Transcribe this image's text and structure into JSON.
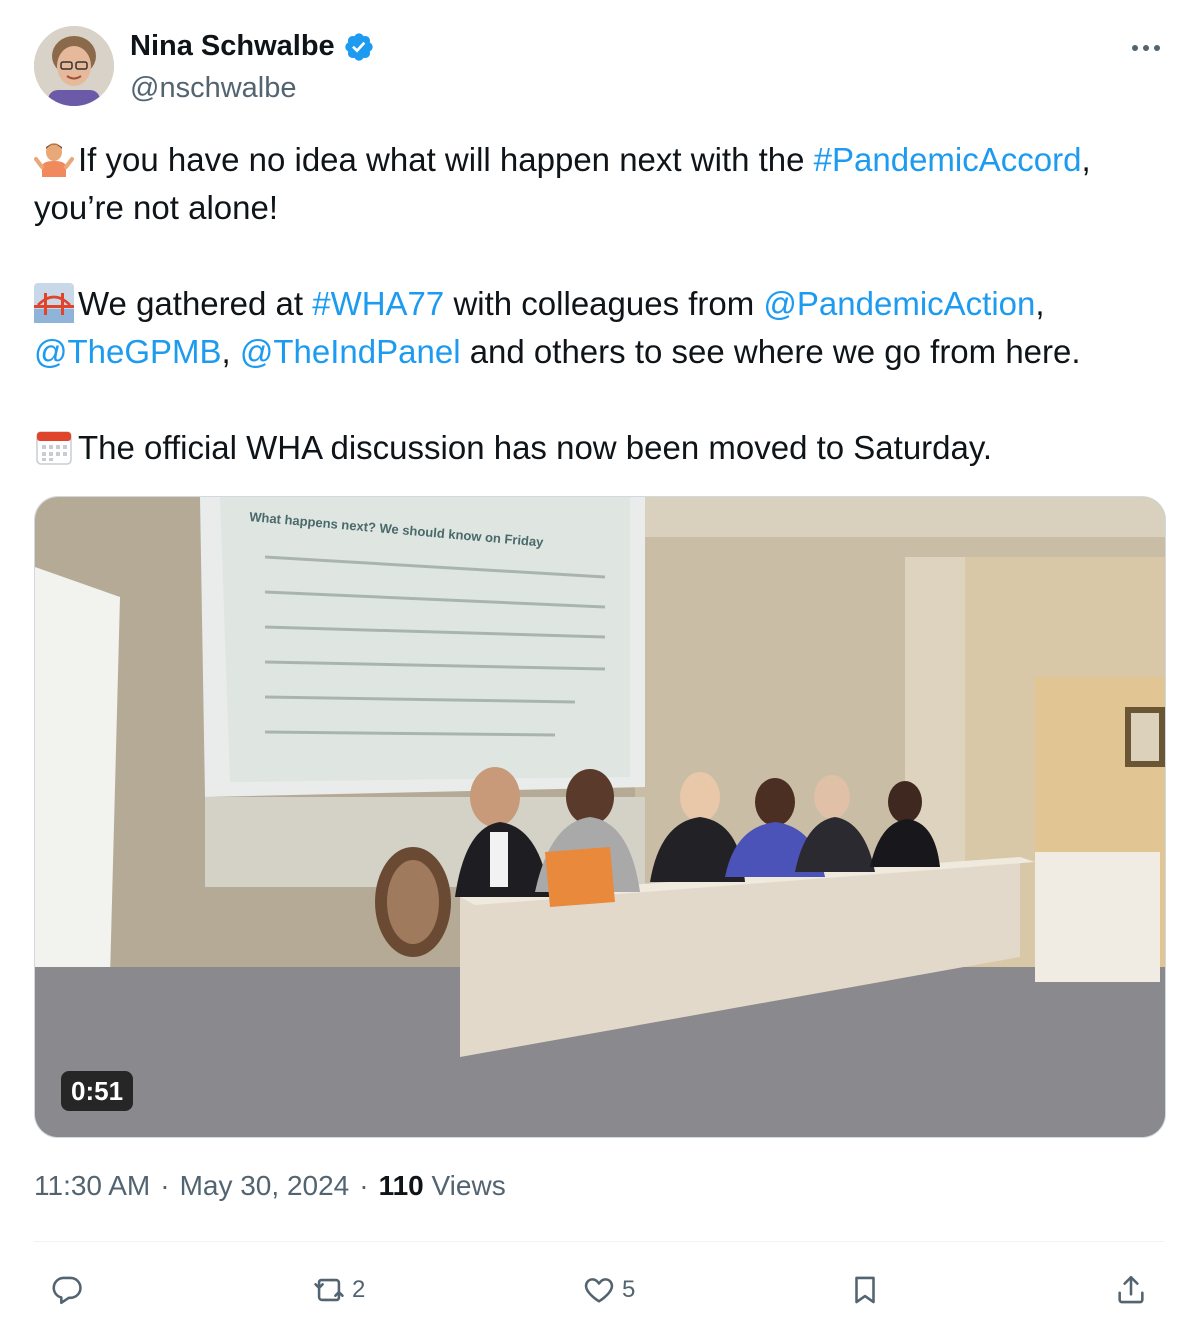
{
  "author": {
    "name": "Nina Schwalbe",
    "handle": "@nschwalbe",
    "verified": true
  },
  "tweet": {
    "line1_emoji": "person-shrugging",
    "line1_text_a": "If you have no idea what will happen next with the ",
    "line1_hashtag": "#PandemicAccord",
    "line1_text_b": ",",
    "line1_text_c": "you’re not alone!",
    "line2_emoji": "bridge-at-night",
    "line2_text_a": "We gathered at ",
    "line2_hashtag": "#WHA77",
    "line2_text_b": " with colleagues from ",
    "line2_mention1": "@PandemicAction",
    "line2_text_c": ",",
    "line2_mention2": "@TheGPMB",
    "line2_text_d": ", ",
    "line2_mention3": "@TheIndPanel",
    "line2_text_e": " and others to see where we go from here.",
    "line3_emoji": "calendar",
    "line3_text": "The official WHA discussion has now been moved to Saturday."
  },
  "media": {
    "type": "video",
    "duration": "0:51",
    "slide_title": "What happens next? We should know on Friday"
  },
  "meta": {
    "time": "11:30 AM",
    "separator": "·",
    "date": "May 30, 2024",
    "views_count": "110",
    "views_label": "Views"
  },
  "actions": {
    "reply_count": "",
    "retweet_count": "2",
    "like_count": "5"
  },
  "colors": {
    "link": "#1d9bf0",
    "secondary_text": "#536471",
    "primary_text": "#0f1419"
  }
}
